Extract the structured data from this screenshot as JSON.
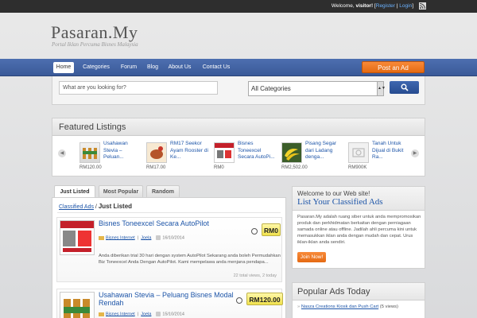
{
  "topbar": {
    "welcome": "Welcome, ",
    "user": "visitor!",
    "sep_open": " [",
    "register": "Register",
    "pipe": " | ",
    "login": "Login",
    "sep_close": "]"
  },
  "site": {
    "logo": "Pasaran.My",
    "tagline": "Portal Iklan Percuma Bisnes Malaysia"
  },
  "nav": {
    "items": [
      "Home",
      "Categories",
      "Forum",
      "Blog",
      "About Us",
      "Contact Us"
    ],
    "active": "Home",
    "post_ad": "Post an Ad"
  },
  "search": {
    "placeholder": "What are you looking for?",
    "category": "All Categories",
    "button_icon": "search-icon"
  },
  "featured": {
    "title": "Featured Listings",
    "items": [
      {
        "title": "Usahawan Stevia – Peluan...",
        "price": "RM120.00"
      },
      {
        "title": "RM17 Seekor Ayam Rooster di Ke...",
        "price": "RM17.00"
      },
      {
        "title": "Bisnes Toneexcel Secara AutoPi...",
        "price": "RM0"
      },
      {
        "title": "Pisang Segar dari Ladang denga...",
        "price": "RM2,502.00"
      },
      {
        "title": "Tanah Untuk Dijual di Bukit Ra...",
        "price": "RM900K"
      }
    ]
  },
  "tabs": [
    "Just Listed",
    "Most Popular",
    "Random"
  ],
  "breadcrumb": {
    "root": "Classified Ads",
    "sep": " / ",
    "current": "Just Listed"
  },
  "ads": [
    {
      "title": "Bisnes Toneexcel Secara AutoPilot",
      "category": "Bisnes Internet",
      "author": "Joela",
      "date": "16/10/2014",
      "price": "RM0",
      "desc": "Anda diberikan trial 30 hari dengan system AutoPilot Sekarang anda boleh Permudahkan Biz Toneexcel Anda Dengan AutoPilot. Kami mempelawa anda menjana pendapa...",
      "stats": "22 total views, 2 today"
    },
    {
      "title": "Usahawan Stevia – Peluang Bisnes Modal Rendah",
      "category": "Bisnes Internet",
      "author": "Joela",
      "date": "15/10/2014",
      "price": "RM120.00"
    }
  ],
  "welcome_widget": {
    "small": "Welcome to our Web site!",
    "big": "List Your Classified Ads",
    "desc": "Pasaran.My adalah ruang siber untuk anda mempromosikan produk dan perkhidmatan berkaitan dengan perniagaan samada online atau offline. Jadilah ahli percuma kini untuk memasukkan iklan anda dengan mudah dan cepat. Urus iklan-iklan anda sendiri.",
    "button": "Join Now!"
  },
  "popular": {
    "title": "Popular Ads Today",
    "items": [
      {
        "name": "Nasza Creations Kiosk dan Push Cart",
        "count": " (5 views)"
      }
    ]
  }
}
